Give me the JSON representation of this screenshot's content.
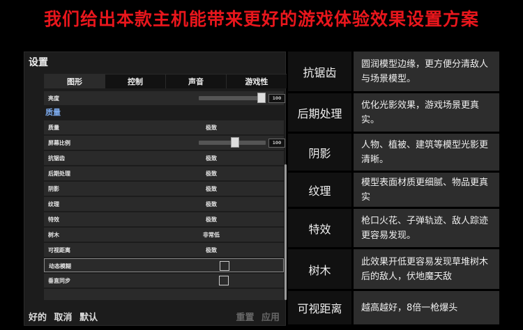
{
  "headline": "我们给出本款主机能带来更好的游戏体验效果设置方案",
  "settings": {
    "title": "设置",
    "tabs": [
      {
        "label": "图形",
        "active": true
      },
      {
        "label": "控制",
        "active": false
      },
      {
        "label": "声音",
        "active": false
      },
      {
        "label": "游戏性",
        "active": false
      }
    ],
    "brightness": {
      "label": "亮度",
      "value": "100",
      "level": 1.0
    },
    "section_quality": "质量",
    "quality": {
      "label": "质量",
      "value": "极致"
    },
    "screen_ratio": {
      "label": "屏幕比例",
      "value": "100",
      "level": 0.55
    },
    "options": [
      {
        "label": "抗锯齿",
        "value": "极致"
      },
      {
        "label": "后期处理",
        "value": "极致"
      },
      {
        "label": "阴影",
        "value": "极致"
      },
      {
        "label": "纹理",
        "value": "极致"
      },
      {
        "label": "特效",
        "value": "极致"
      },
      {
        "label": "树木",
        "value": "非常低"
      },
      {
        "label": "可视距离",
        "value": "极致"
      }
    ],
    "motion_blur": {
      "label": "动态模糊",
      "checked": false
    },
    "vsync": {
      "label": "垂直同步",
      "checked": false
    },
    "bottom_left": [
      "好的",
      "取消",
      "默认"
    ],
    "bottom_right": [
      "重置",
      "应用"
    ]
  },
  "features": [
    {
      "name": "抗锯齿",
      "desc": "圆润模型边缘，更方便分清敌人与场景模型。"
    },
    {
      "name": "后期处理",
      "desc": "优化光影效果，游戏场景更真实。"
    },
    {
      "name": "阴影",
      "desc": "人物、植被、建筑等模型光影更清晰。"
    },
    {
      "name": "纹理",
      "desc": "模型表面材质更细腻、物品更真实"
    },
    {
      "name": "特效",
      "desc": "枪口火花、子弹轨迹、敌人踪迹更容易发现。"
    },
    {
      "name": "树木",
      "desc": "此效果开低更容易发现草堆树木后的敌人，伏地魔天敌"
    },
    {
      "name": "可视距离",
      "desc": "越高越好，8倍一枪爆头"
    }
  ]
}
